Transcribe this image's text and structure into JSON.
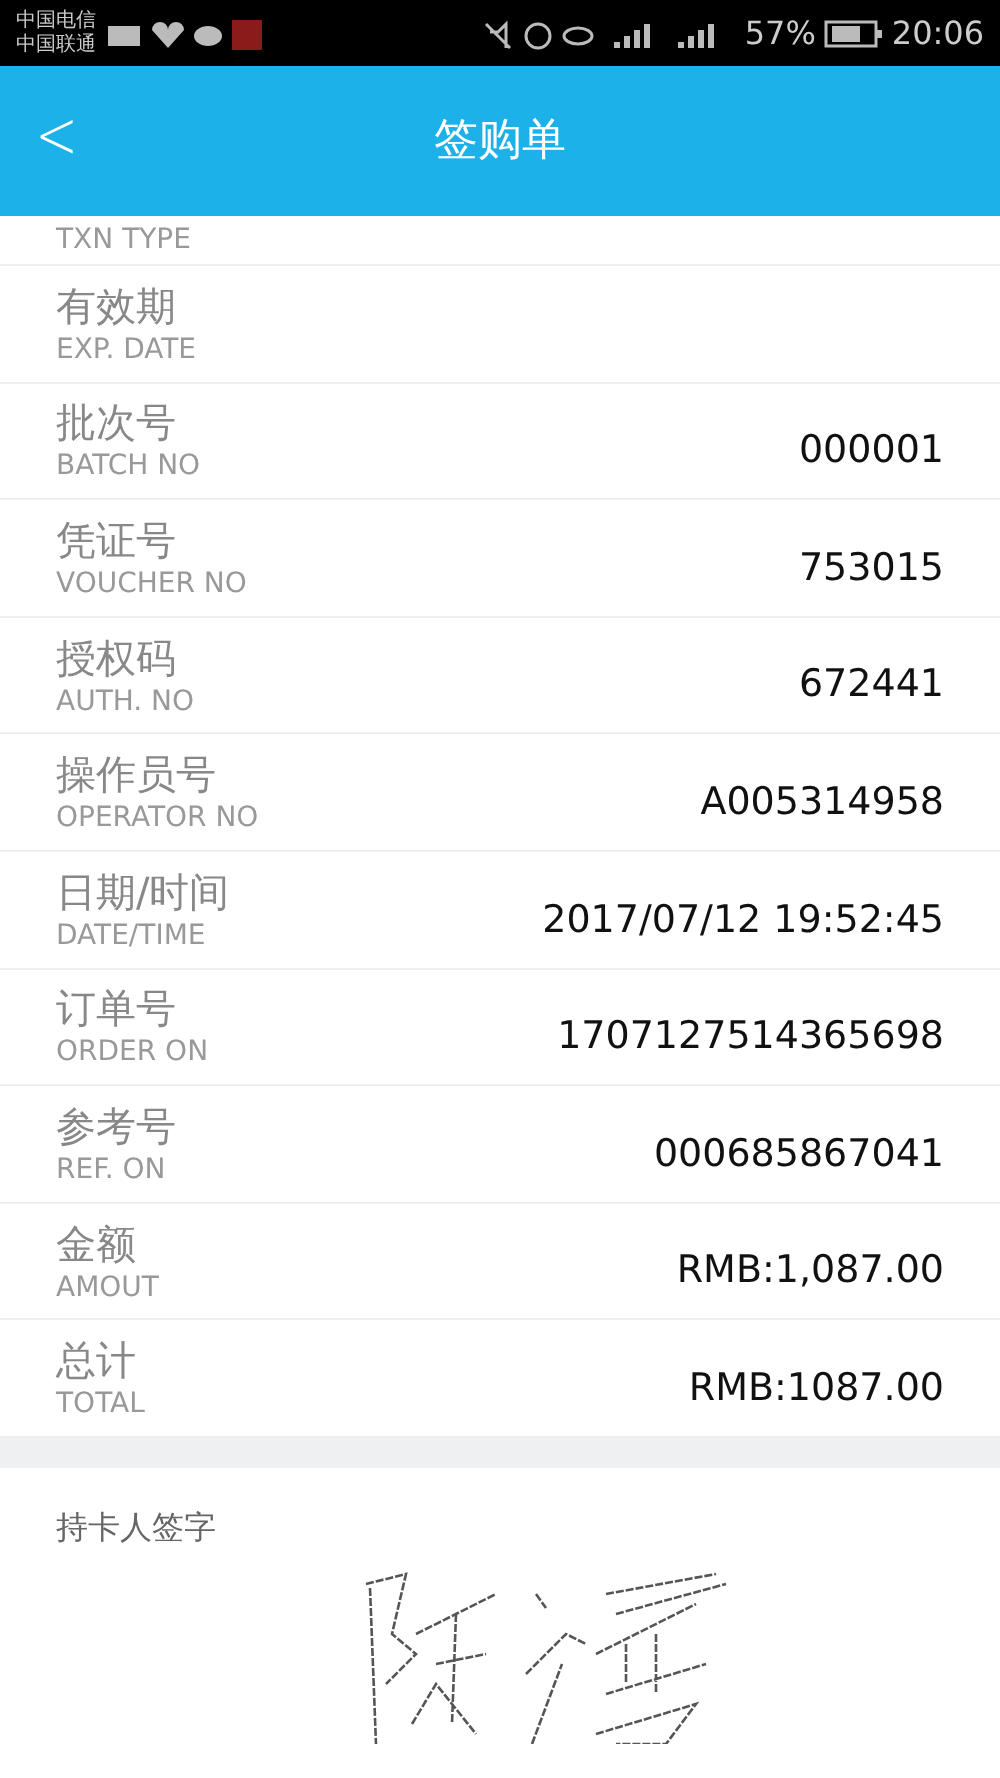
{
  "status_bar": {
    "carriers": [
      "中国电信",
      "中国联通"
    ],
    "battery": "57%",
    "time": "20:06"
  },
  "header": {
    "back": "<",
    "title": "签购单"
  },
  "partial_row": {
    "label_en": "TXN TYPE"
  },
  "rows": [
    {
      "label_cn": "有效期",
      "label_en": "EXP. DATE"
    },
    {
      "label_cn": "批次号",
      "label_en": "BATCH NO",
      "value": "000001"
    },
    {
      "label_cn": "凭证号",
      "label_en": "VOUCHER NO",
      "value": "753015"
    },
    {
      "label_cn": "授权码",
      "label_en": "AUTH. NO",
      "value": "672441"
    },
    {
      "label_cn": "操作员号",
      "label_en": "OPERATOR NO",
      "value": "A005314958"
    },
    {
      "label_cn": "日期/时间",
      "label_en": "DATE/TIME",
      "value": "2017/07/12 19:52:45"
    },
    {
      "label_cn": "订单号",
      "label_en": "ORDER ON",
      "value": "1707127514365698"
    },
    {
      "label_cn": "参考号",
      "label_en": "REF. ON",
      "value": "000685867041"
    },
    {
      "label_cn": "金额",
      "label_en": "AMOUT",
      "value": "RMB:1,087.00"
    },
    {
      "label_cn": "总计",
      "label_en": "TOTAL",
      "value": "RMB:1087.00"
    }
  ],
  "signature": {
    "label": "持卡人签字"
  }
}
